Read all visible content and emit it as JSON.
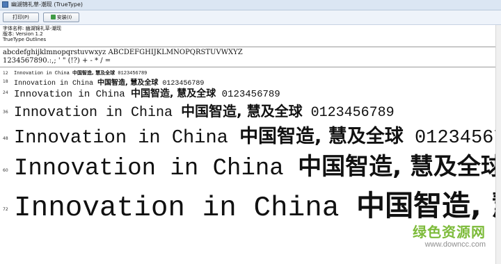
{
  "window": {
    "title": "幽湖锦礼草-潮现 (TrueType)"
  },
  "toolbar": {
    "print_label": "打印(P)",
    "install_label": "安装(I)"
  },
  "font_info": {
    "name": "字体名称: 幽湖锦礼草-潮现",
    "version": "版本: Version 1.2",
    "outlines": "TrueType Outlines"
  },
  "charset": {
    "line1": "abcdefghijklmnopqrstuvwxyz ABCDEFGHIJKLMNOPQRSTUVWXYZ",
    "line2": "1234567890.:,; ' \" (!?) + - * / ="
  },
  "sample_parts": {
    "latin": "Innovation in China",
    "cjk": "中国智造, 慧及全球",
    "digits": "0123456789"
  },
  "size_rows": [
    {
      "size": "12"
    },
    {
      "size": "18"
    },
    {
      "size": "24"
    },
    {
      "size": "36"
    },
    {
      "size": "48"
    },
    {
      "size": "60"
    },
    {
      "size": "72"
    }
  ],
  "watermark": {
    "main": "绿色资源网",
    "url": "www.downcc.com"
  }
}
